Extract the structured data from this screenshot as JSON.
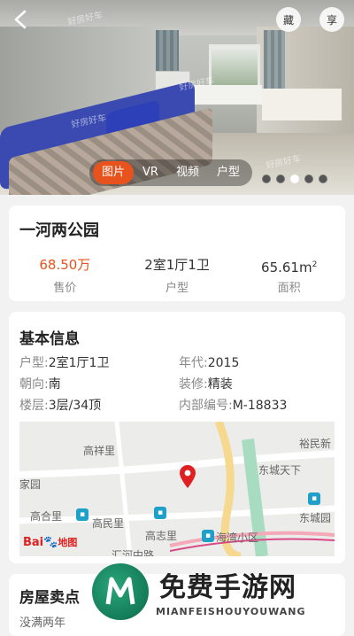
{
  "hero": {
    "watermark": "好房好车",
    "favorite_label": "藏",
    "share_label": "享",
    "tabs": [
      "图片",
      "VR",
      "视频",
      "户型"
    ],
    "active_tab": 0,
    "dots_count": 5,
    "active_dot": 2
  },
  "summary": {
    "title": "一河两公园",
    "price_value": "68.50万",
    "price_label": "售价",
    "layout_value": "2室1厅1卫",
    "layout_label": "户型",
    "area_value": "65.61m",
    "area_unit": "2",
    "area_label": "面积"
  },
  "basic_info": {
    "title": "基本信息",
    "rows": [
      [
        {
          "key": "户型:",
          "value": "2室1厅1卫"
        },
        {
          "key": "年代:",
          "value": "2015"
        }
      ],
      [
        {
          "key": "朝向:",
          "value": "南"
        },
        {
          "key": "装修:",
          "value": "精装"
        }
      ],
      [
        {
          "key": "楼层:",
          "value": "3层/34顶"
        },
        {
          "key": "内部编号:",
          "value": "M-18833"
        }
      ]
    ]
  },
  "map": {
    "labels": [
      "高祥里",
      "裕民新",
      "家园",
      "东城天下",
      "高合里",
      "高民里",
      "东城园",
      "高志里",
      "海湾小区",
      "汇河中路"
    ],
    "logo_text": "Bai",
    "logo_text2": "地图"
  },
  "selling_points": {
    "title": "房屋卖点",
    "subtitle": "没满两年"
  },
  "banner": {
    "title": "免费手游网",
    "subtitle": "MIANFEISHOUYOUWANG"
  },
  "colors": {
    "accent": "#e8531d",
    "poi": "#1ea0c8",
    "pin": "#e02020"
  }
}
